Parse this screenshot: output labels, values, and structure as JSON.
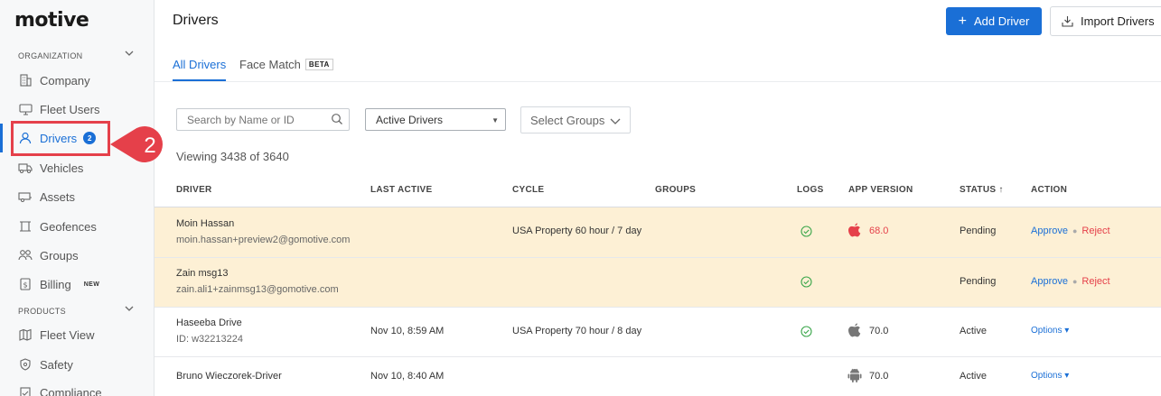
{
  "brand": {
    "logo": "motive"
  },
  "sidebar": {
    "org_header": "ORGANIZATION",
    "products_header": "PRODUCTS",
    "items": [
      {
        "label": "Company",
        "icon": "building-icon"
      },
      {
        "label": "Fleet Users",
        "icon": "monitor-icon"
      },
      {
        "label": "Drivers",
        "icon": "person-icon",
        "badge": "2",
        "active": true
      },
      {
        "label": "Vehicles",
        "icon": "truck-icon"
      },
      {
        "label": "Assets",
        "icon": "trailer-icon"
      },
      {
        "label": "Geofences",
        "icon": "geofence-icon"
      },
      {
        "label": "Groups",
        "icon": "groups-icon"
      },
      {
        "label": "Billing",
        "icon": "billing-icon",
        "tag": "NEW"
      }
    ],
    "product_items": [
      {
        "label": "Fleet View",
        "icon": "map-icon"
      },
      {
        "label": "Safety",
        "icon": "shield-icon"
      },
      {
        "label": "Compliance",
        "icon": "compliance-icon"
      }
    ]
  },
  "callout": {
    "number": "2",
    "color": "#e5404a"
  },
  "header": {
    "title": "Drivers",
    "add_button": "Add Driver",
    "import_button": "Import Drivers"
  },
  "tabs": [
    {
      "label": "All Drivers",
      "active": true
    },
    {
      "label": "Face Match",
      "tag": "BETA"
    }
  ],
  "filters": {
    "search_placeholder": "Search by Name or ID",
    "status_select": "Active Drivers",
    "groups_select": "Select Groups"
  },
  "viewing_text": "Viewing 3438 of 3640",
  "table": {
    "columns": [
      "DRIVER",
      "LAST ACTIVE",
      "CYCLE",
      "GROUPS",
      "LOGS",
      "APP VERSION",
      "STATUS ↑",
      "ACTION"
    ],
    "rows": [
      {
        "name": "Moin Hassan",
        "sub": "moin.hassan+preview2@gomotive.com",
        "last_active": "",
        "cycle": "USA Property 60 hour / 7 day",
        "groups": "",
        "logs": true,
        "platform": "apple",
        "app_version": "68.0",
        "status": "Pending",
        "actions": [
          "Approve",
          "Reject"
        ]
      },
      {
        "name": "Zain msg13",
        "sub": "zain.ali1+zainmsg13@gomotive.com",
        "last_active": "",
        "cycle": "",
        "groups": "",
        "logs": true,
        "platform": "",
        "app_version": "",
        "status": "Pending",
        "actions": [
          "Approve",
          "Reject"
        ]
      },
      {
        "name": "Haseeba Drive",
        "sub": "ID: w32213224",
        "last_active": "Nov 10, 8:59 AM",
        "cycle": "USA Property 70 hour / 8 day",
        "groups": "",
        "logs": true,
        "platform": "apple",
        "app_version": "70.0",
        "status": "Active",
        "actions": [
          "Options ▾"
        ]
      },
      {
        "name": "Bruno Wieczorek-Driver",
        "sub": "",
        "last_active": "Nov 10, 8:40 AM",
        "cycle": "",
        "groups": "",
        "logs": false,
        "platform": "android",
        "app_version": "70.0",
        "status": "Active",
        "actions": [
          "Options ▾"
        ]
      }
    ]
  }
}
